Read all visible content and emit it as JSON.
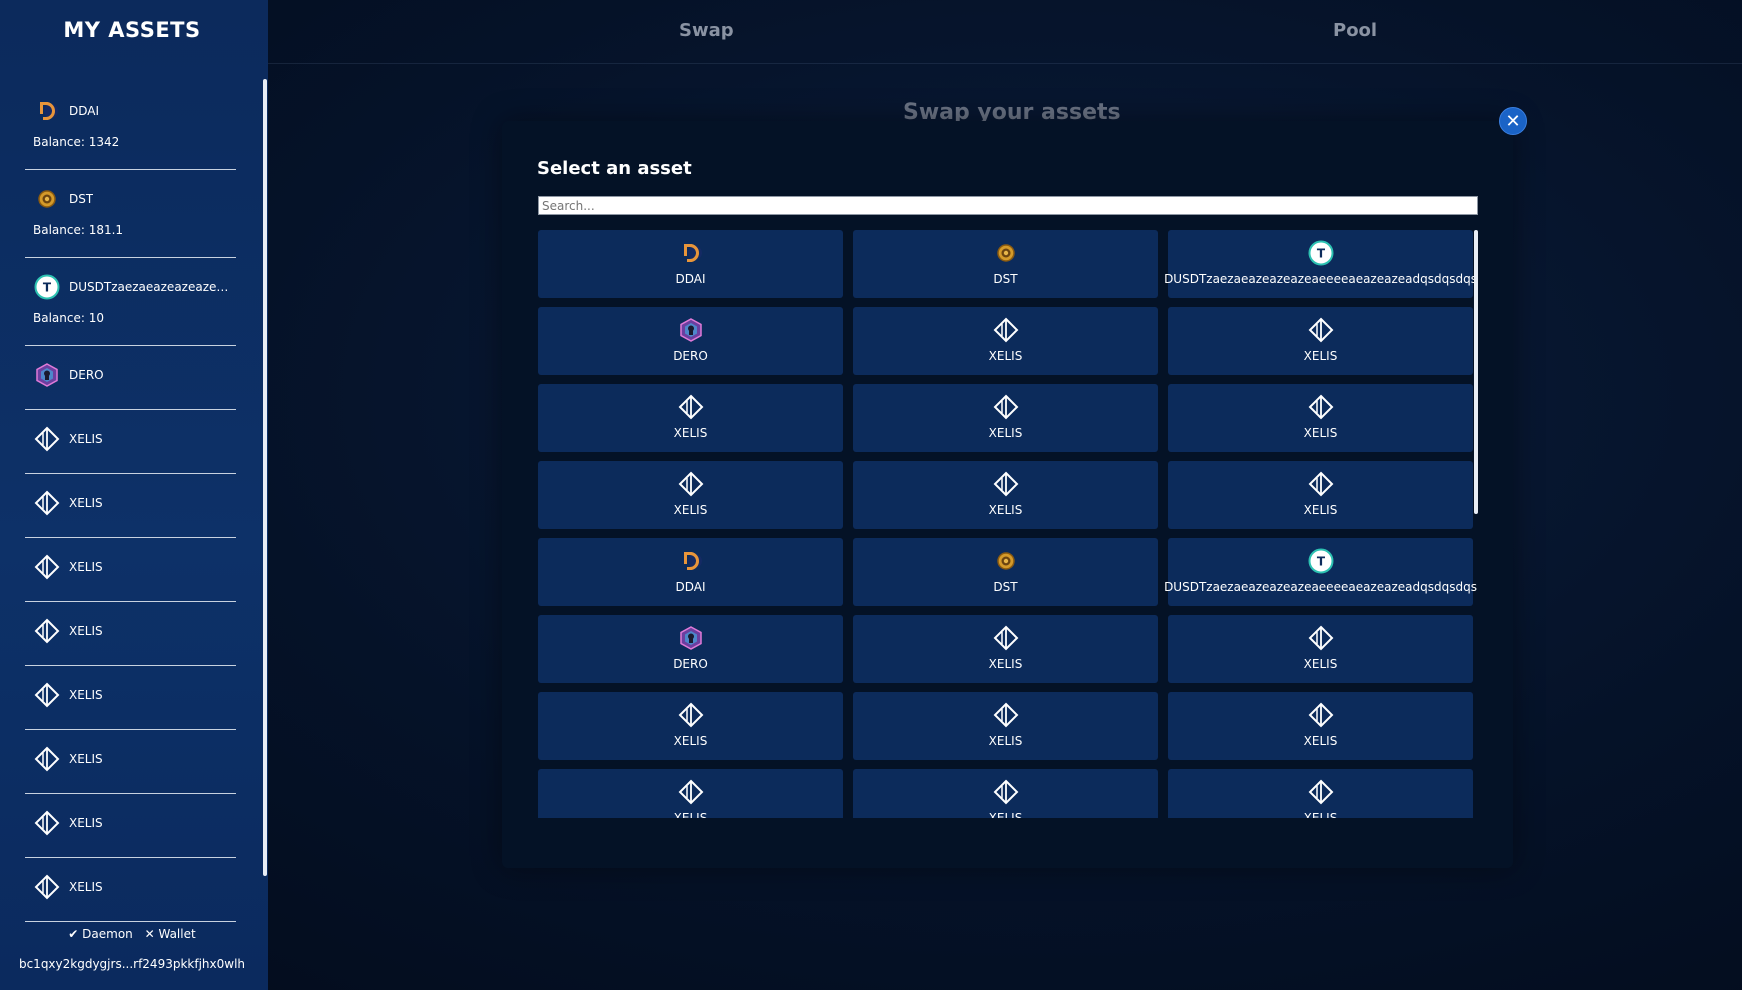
{
  "sidebar": {
    "title": "MY ASSETS",
    "assets": [
      {
        "name": "DDAI",
        "icon": "ddai-icon",
        "balance": "Balance: 1342"
      },
      {
        "name": "DST",
        "icon": "dst-icon",
        "balance": "Balance: 181.1"
      },
      {
        "name": "DUSDTzaezaeazeazeazeazeaze",
        "icon": "dusdt-icon",
        "balance": "Balance: 10"
      },
      {
        "name": "DERO",
        "icon": "dero-icon"
      },
      {
        "name": "XELIS",
        "icon": "xelis-icon"
      },
      {
        "name": "XELIS",
        "icon": "xelis-icon"
      },
      {
        "name": "XELIS",
        "icon": "xelis-icon"
      },
      {
        "name": "XELIS",
        "icon": "xelis-icon"
      },
      {
        "name": "XELIS",
        "icon": "xelis-icon"
      },
      {
        "name": "XELIS",
        "icon": "xelis-icon"
      },
      {
        "name": "XELIS",
        "icon": "xelis-icon"
      },
      {
        "name": "XELIS",
        "icon": "xelis-icon"
      }
    ],
    "daemon_status": "✔ Daemon",
    "wallet_status": "✕ Wallet",
    "address": "bc1qxy2kgdygjrs...rf2493pkkfjhx0wlh"
  },
  "tabs": {
    "swap": "Swap",
    "pool": "Pool"
  },
  "background_heading": "Swap your assets",
  "modal": {
    "title": "Select an asset",
    "search_placeholder": "Search...",
    "assets": [
      "DDAI",
      "DST",
      "DUSDTzaezaeazeazeazeaeeeeaeazeazeadqsdqsdqs",
      "DERO",
      "XELIS",
      "XELIS",
      "XELIS",
      "XELIS",
      "XELIS",
      "XELIS",
      "XELIS",
      "XELIS",
      "DDAI",
      "DST",
      "DUSDTzaezaeazeazeazeaeeeeaeazeazeadqsdqsdqs",
      "DERO",
      "XELIS",
      "XELIS",
      "XELIS",
      "XELIS",
      "XELIS",
      "XELIS",
      "XELIS",
      "XELIS"
    ]
  },
  "colors": {
    "accent": "#1a63c6",
    "card": "#0c2b5b",
    "sidebar": "#0d3168"
  }
}
